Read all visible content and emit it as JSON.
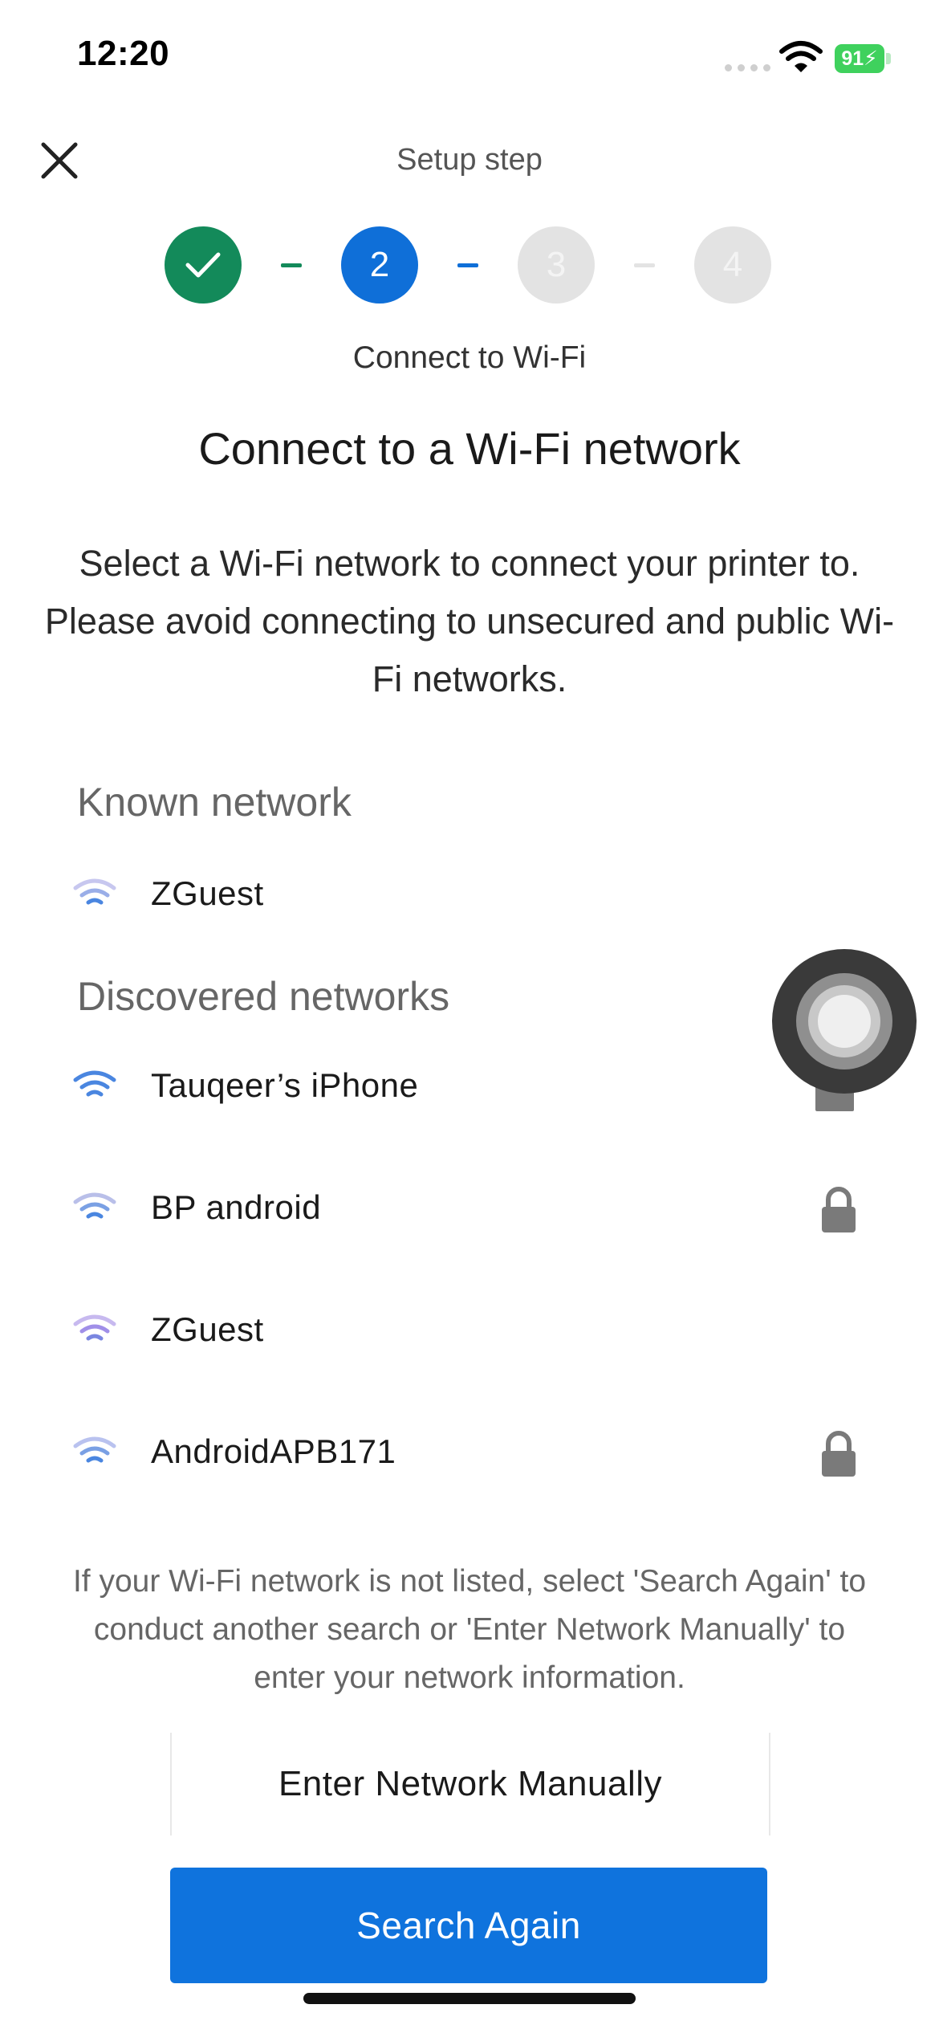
{
  "status_bar": {
    "time": "12:20",
    "battery": "91",
    "battery_color": "#3fd15d"
  },
  "header": {
    "close_icon": "close-icon",
    "title": "Setup step"
  },
  "stepper": {
    "steps": [
      {
        "label": "",
        "state": "complete",
        "icon": "check-icon"
      },
      {
        "label": "2",
        "state": "current"
      },
      {
        "label": "3",
        "state": "upcoming"
      },
      {
        "label": "4",
        "state": "upcoming"
      }
    ],
    "caption": "Connect to Wi-Fi",
    "complete_color": "#138a5a",
    "current_color": "#0f6fd8",
    "upcoming_color": "#e3e3e3"
  },
  "main": {
    "title": "Connect to a Wi-Fi network",
    "intro": "Select a Wi-Fi network to connect your printer to. Please avoid connecting to unsecured and public Wi-Fi networks."
  },
  "known": {
    "heading": "Known network",
    "networks": [
      {
        "name": "ZGuest",
        "secured": false,
        "icon": "wifi-icon"
      }
    ]
  },
  "discovered": {
    "heading": "Discovered networks",
    "networks": [
      {
        "name": "Tauqeer’s iPhone",
        "secured": true,
        "icon": "wifi-icon"
      },
      {
        "name": "BP android",
        "secured": true,
        "icon": "wifi-icon"
      },
      {
        "name": "ZGuest",
        "secured": false,
        "icon": "wifi-icon"
      },
      {
        "name": "AndroidAPB171",
        "secured": true,
        "icon": "wifi-icon"
      }
    ]
  },
  "help_text": "If your Wi-Fi network is not listed, select 'Search Again' to conduct another search or 'Enter Network Manually' to enter your network information.",
  "buttons": {
    "manual": "Enter Network Manually",
    "search": "Search Again",
    "primary_color": "#0f73dd"
  }
}
